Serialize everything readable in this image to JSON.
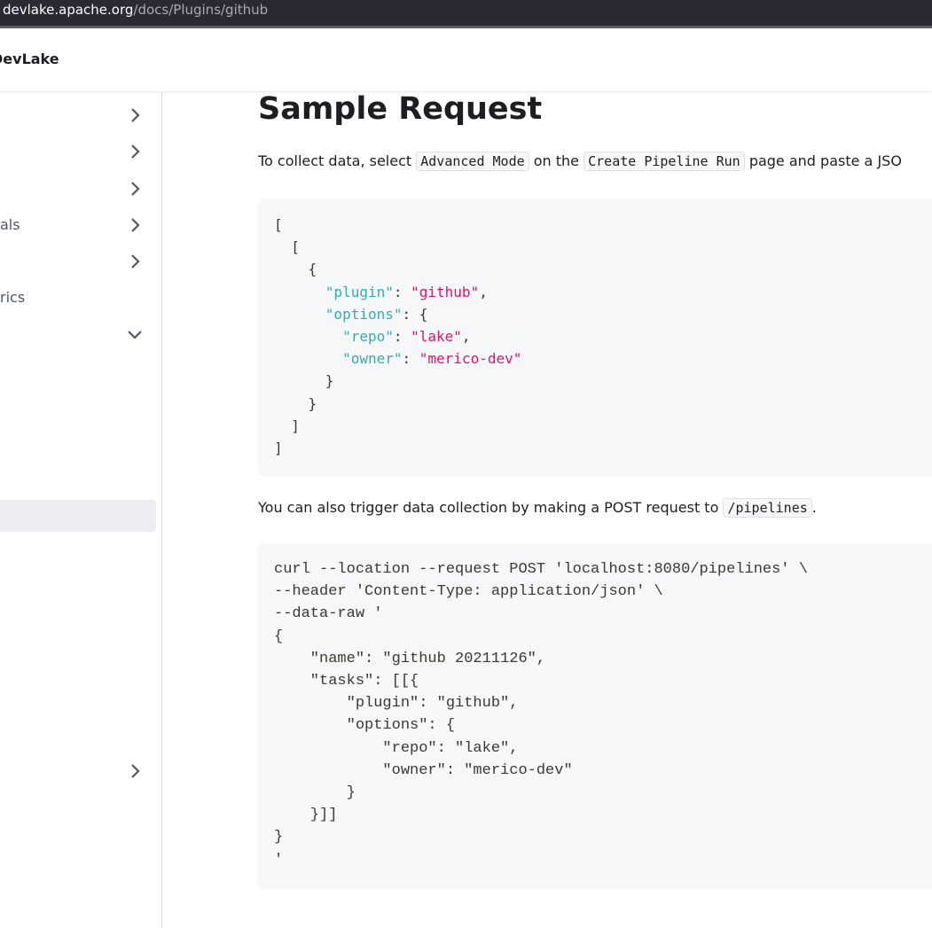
{
  "browser": {
    "url_host": "devlake.apache.org",
    "url_path": "/docs/Plugins/github"
  },
  "navbar": {
    "brand": "DevLake"
  },
  "sidebar": {
    "items": [
      {
        "label": "",
        "chevron": "right"
      },
      {
        "label": "",
        "chevron": "right"
      },
      {
        "label": "",
        "chevron": "right"
      },
      {
        "label": "als",
        "chevron": "right"
      },
      {
        "label": "",
        "chevron": "right"
      },
      {
        "label": "rics",
        "chevron": ""
      },
      {
        "label": "",
        "chevron": "down"
      },
      {
        "label": "",
        "chevron": "right"
      }
    ]
  },
  "content": {
    "title": "Sample Request",
    "intro_text_1": "To collect data, select",
    "intro_code_1": "Advanced Mode",
    "intro_text_2": "on the",
    "intro_code_2": "Create Pipeline Run",
    "intro_text_3": "page and paste a JSO",
    "json_block": {
      "lines": [
        [
          {
            "t": "punc",
            "v": "["
          }
        ],
        [
          {
            "t": "punc",
            "v": "  ["
          }
        ],
        [
          {
            "t": "punc",
            "v": "    {"
          }
        ],
        [
          {
            "t": "punc",
            "v": "      "
          },
          {
            "t": "key",
            "v": "\"plugin\""
          },
          {
            "t": "punc",
            "v": ": "
          },
          {
            "t": "str",
            "v": "\"github\""
          },
          {
            "t": "punc",
            "v": ","
          }
        ],
        [
          {
            "t": "punc",
            "v": "      "
          },
          {
            "t": "key",
            "v": "\"options\""
          },
          {
            "t": "punc",
            "v": ": {"
          }
        ],
        [
          {
            "t": "punc",
            "v": "        "
          },
          {
            "t": "key",
            "v": "\"repo\""
          },
          {
            "t": "punc",
            "v": ": "
          },
          {
            "t": "str",
            "v": "\"lake\""
          },
          {
            "t": "punc",
            "v": ","
          }
        ],
        [
          {
            "t": "punc",
            "v": "        "
          },
          {
            "t": "key",
            "v": "\"owner\""
          },
          {
            "t": "punc",
            "v": ": "
          },
          {
            "t": "str",
            "v": "\"merico-dev\""
          }
        ],
        [
          {
            "t": "punc",
            "v": "      }"
          }
        ],
        [
          {
            "t": "punc",
            "v": "    }"
          }
        ],
        [
          {
            "t": "punc",
            "v": "  ]"
          }
        ],
        [
          {
            "t": "punc",
            "v": "]"
          }
        ]
      ]
    },
    "post_text_1": "You can also trigger data collection by making a POST request to",
    "post_code": "/pipelines",
    "post_text_2": ".",
    "curl_block": {
      "lines": [
        "curl --location --request POST 'localhost:8080/pipelines' \\",
        "--header 'Content-Type: application/json' \\",
        "--data-raw '",
        "{",
        "    \"name\": \"github 20211126\",",
        "    \"tasks\": [[{",
        "        \"plugin\": \"github\",",
        "        \"options\": {",
        "            \"repo\": \"lake\",",
        "            \"owner\": \"merico-dev\"",
        "        }",
        "    }]]",
        "}",
        "'"
      ]
    }
  },
  "colors": {
    "key": "#36acaa",
    "string": "#e3116c",
    "code_bg": "#f6f7f8"
  }
}
